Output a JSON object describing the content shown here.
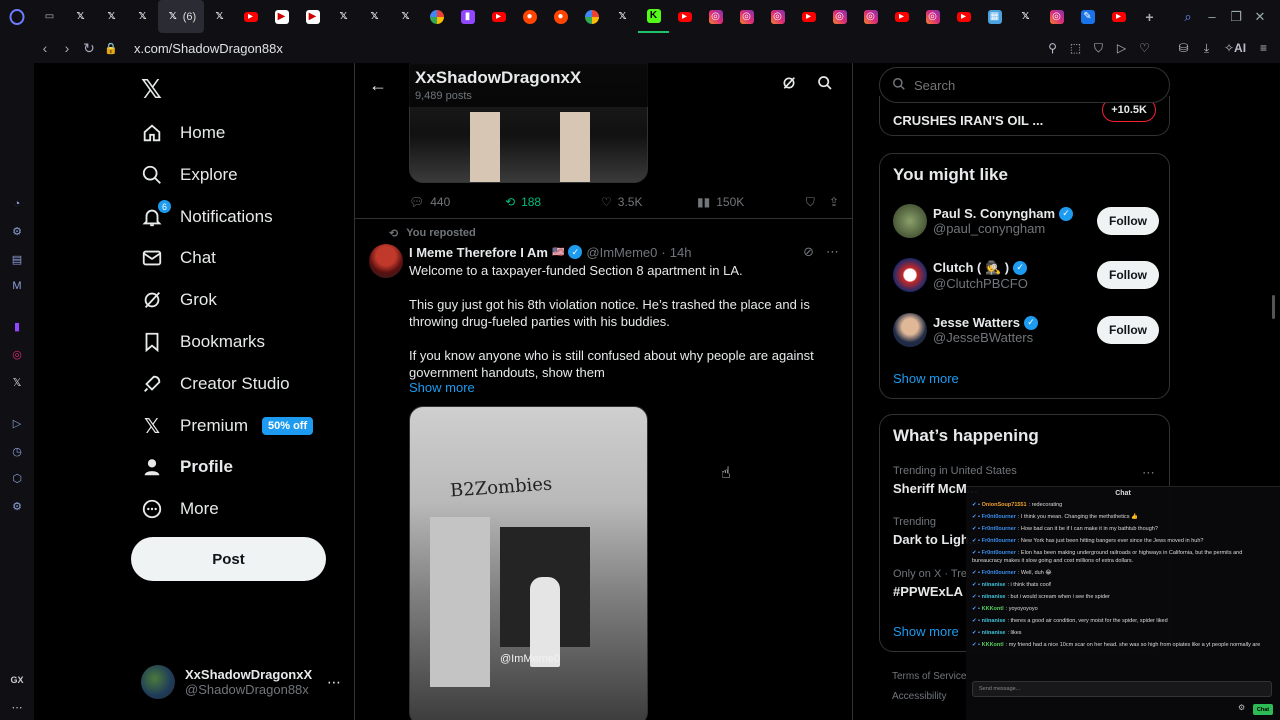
{
  "browser": {
    "tab_count_label": "(6)",
    "url": "x.com/ShadowDragon88x",
    "ai_label": "AI",
    "colors": {
      "tab_selected_underline": "#20c26b"
    }
  },
  "nav": {
    "items": [
      {
        "label": "Home",
        "icon": "home-icon"
      },
      {
        "label": "Explore",
        "icon": "search-icon"
      },
      {
        "label": "Notifications",
        "icon": "bell-icon",
        "badge": "6"
      },
      {
        "label": "Chat",
        "icon": "mail-icon"
      },
      {
        "label": "Grok",
        "icon": "grok-icon"
      },
      {
        "label": "Bookmarks",
        "icon": "bookmark-icon"
      },
      {
        "label": "Creator Studio",
        "icon": "rocket-icon"
      },
      {
        "label": "Premium",
        "icon": "x-icon",
        "promo": "50% off"
      },
      {
        "label": "Profile",
        "icon": "person-icon"
      },
      {
        "label": "More",
        "icon": "more-icon"
      }
    ],
    "post_label": "Post",
    "account": {
      "name": "XxShadowDragonxX",
      "handle": "@ShadowDragon88x"
    }
  },
  "header": {
    "title": "XxShadowDragonxX",
    "subtitle": "9,489 posts"
  },
  "prev_post_actions": {
    "replies": "440",
    "reposts": "188",
    "likes": "3.5K",
    "views": "150K"
  },
  "tweet": {
    "repost_label": "You reposted",
    "author": "I Meme Therefore I Am",
    "flag": "🇺🇸",
    "handle": "@ImMeme0",
    "time": "14h",
    "paragraphs": [
      "Welcome to a taxpayer-funded Section 8 apartment in LA.",
      "This guy just got his 8th violation notice. He’s trashed the place and is throwing drug-fueled parties with his buddies.",
      "If you know anyone who is still confused about why people are against government handouts, show them"
    ],
    "show_more": "Show more",
    "media_wall_text": "B2Zombies",
    "media_watermark": "@ImMeme0"
  },
  "right": {
    "search_placeholder": "Search",
    "partial_trend_title": "CRUSHES IRAN'S OIL ...",
    "partial_trend_count": "+10.5K",
    "who_to_follow": {
      "title": "You might like",
      "follow_label": "Follow",
      "show_more": "Show more",
      "people": [
        {
          "name": "Paul S. Conyngham",
          "handle": "@paul_conyngham"
        },
        {
          "name": "Clutch ( 🕵 )",
          "handle": "@ClutchPBCFO"
        },
        {
          "name": "Jesse Watters",
          "handle": "@JesseBWatters"
        }
      ]
    },
    "happening": {
      "title": "What’s happening",
      "show_more": "Show more",
      "trends": [
        {
          "meta": "Trending in United States",
          "title": "Sheriff McM..."
        },
        {
          "meta": "Trending",
          "title": "Dark to Ligh..."
        },
        {
          "meta": "Only on X · Tre...",
          "title": "#PPWExLA"
        }
      ]
    },
    "footer_links": [
      "Terms of Service",
      "Accessibility"
    ]
  },
  "chat_overlay": {
    "title": "Chat",
    "messages": [
      {
        "user": "OnionSoup71551",
        "color": "#f0a030",
        "text": "redecorating"
      },
      {
        "user": "Fr0nt0ourner",
        "color": "#3a8ef0",
        "text": "I think you mean. Changing the methsthetics 👍"
      },
      {
        "user": "Fr0nt0ourner",
        "color": "#3a8ef0",
        "text": "How bad can it be if I can make it in my bathtub though?"
      },
      {
        "user": "Fr0nt0ourner",
        "color": "#3a8ef0",
        "text": "New York has just been hitting bangers ever since the Jews moved in huh?"
      },
      {
        "user": "Fr0nt0ourner",
        "color": "#3a8ef0",
        "text": "Elon has been making underground railroads or highways in California, but the permits and bureaucracy makes it slow going and cost millions of extra dollars."
      },
      {
        "user": "Fr0nt0ourner",
        "color": "#3a8ef0",
        "text": "Well, duh 😂"
      },
      {
        "user": "niinanise",
        "color": "#42c1d6",
        "text": "i think thats cool!"
      },
      {
        "user": "niinanise",
        "color": "#42c1d6",
        "text": "but i would scream when i see the spider"
      },
      {
        "user": "KKKontl",
        "color": "#57d05f",
        "text": "yoyoyoyoyo"
      },
      {
        "user": "niinanise",
        "color": "#42c1d6",
        "text": "theres a good air condition, very moist for the spider, spider liked"
      },
      {
        "user": "niinanise",
        "color": "#42c1d6",
        "text": "likes"
      },
      {
        "user": "KKKontl",
        "color": "#57d05f",
        "text": "my friend had a nice 10cm scar on her head. she was so high from opiates like a yt people normally are"
      }
    ],
    "input_placeholder": "Send message...",
    "chat_button": "Chat"
  }
}
